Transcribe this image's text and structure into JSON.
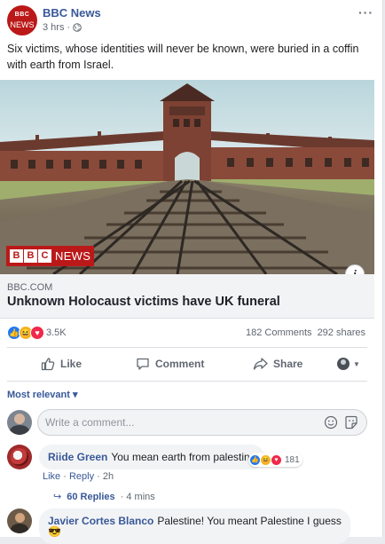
{
  "post": {
    "page_name": "BBC News",
    "avatar_line1": "BBC",
    "avatar_line2": "NEWS",
    "time": "3 hrs",
    "dot": "·",
    "more": "···",
    "text": "Six victims, whose identities will never be known, were buried in a coffin with earth from Israel."
  },
  "link": {
    "badge_letters": [
      "B",
      "B",
      "C"
    ],
    "badge_word": "NEWS",
    "info": "i",
    "domain": "BBC.COM",
    "title": "Unknown Holocaust victims have UK funeral"
  },
  "stats": {
    "reaction_icons": [
      "like-icon",
      "haha-icon",
      "love-icon"
    ],
    "reaction_count": "3.5K",
    "comments": "182 Comments",
    "shares": "292 shares"
  },
  "actions": {
    "like": "Like",
    "comment": "Comment",
    "share": "Share"
  },
  "sort": {
    "label": "Most relevant ▾"
  },
  "composer": {
    "placeholder": "Write a comment..."
  },
  "comments": [
    {
      "name": "Riide Green",
      "text": "You mean earth from palestine",
      "reaction_count": "181",
      "like": "Like",
      "reply": "Reply",
      "time": "2h",
      "sep": " · "
    },
    {
      "name": "Javier Cortes Blanco",
      "text": "Palestine! You meant Palestine I guess",
      "emoji": "😎"
    }
  ],
  "replies": {
    "label": "60 Replies",
    "time": "· 4 mins"
  },
  "colors": {
    "link_blue": "#385898",
    "bbc_red": "#bb1919",
    "like_blue": "#2078f4",
    "love_red": "#f0284a",
    "haha_yellow": "#f7b125"
  }
}
